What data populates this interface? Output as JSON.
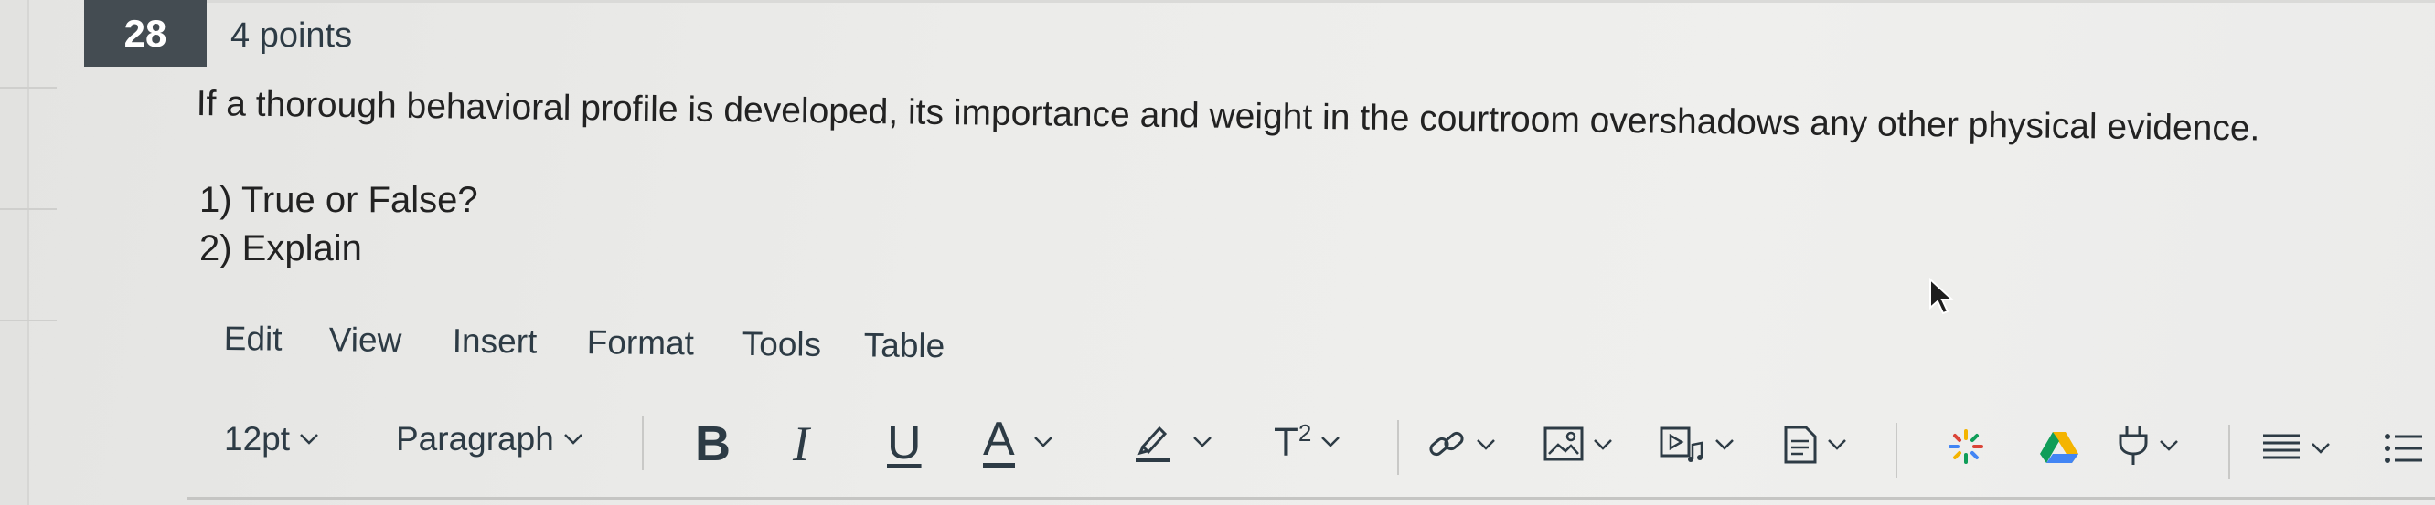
{
  "question": {
    "number": "28",
    "points": "4 points",
    "text": "If a thorough behavioral profile is developed, its importance and weight in the courtroom overshadows any other physical evidence.",
    "items": [
      "1) True or False?",
      "2) Explain"
    ]
  },
  "menubar": {
    "items": [
      "Edit",
      "View",
      "Insert",
      "Format",
      "Tools",
      "Table"
    ]
  },
  "toolbar": {
    "font_size": "12pt",
    "block_format": "Paragraph",
    "bold": "B",
    "italic": "I",
    "underline": "U",
    "text_color": "A",
    "superscript": "T",
    "superscript_exp": "2",
    "icons": [
      "chevron-down-icon",
      "highlighter-icon",
      "link-icon",
      "image-icon",
      "media-icon",
      "document-icon",
      "apps-icon",
      "google-drive-icon",
      "plug-icon",
      "align-icon",
      "list-icon",
      "mouse-pointer-icon"
    ]
  },
  "colors": {
    "badge": "#444c52",
    "text": "#2d3b45",
    "drive_green": "#0f9d58",
    "drive_yellow": "#f4b400",
    "drive_blue": "#4285f4"
  }
}
